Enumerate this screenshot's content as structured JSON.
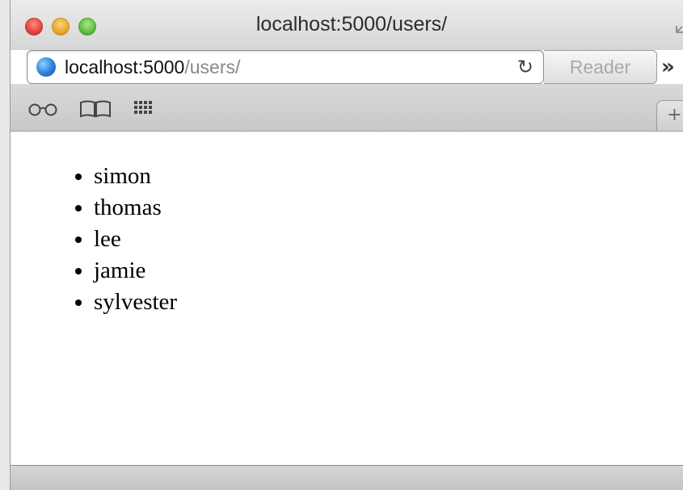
{
  "window": {
    "title": "localhost:5000/users/"
  },
  "address_bar": {
    "host": "localhost:5000",
    "path": "/users/",
    "reader_label": "Reader"
  },
  "icons": {
    "globe": "globe-icon",
    "reload": "reload-icon",
    "reading_list": "glasses-icon",
    "bookmarks": "book-icon",
    "top_sites": "grid-icon",
    "overflow": "chevron-double-right-icon",
    "new_tab": "plus-icon",
    "fullscreen": "fullscreen-icon"
  },
  "page": {
    "users": [
      "simon",
      "thomas",
      "lee",
      "jamie",
      "sylvester"
    ]
  },
  "colors": {
    "close": "#e0443e",
    "minimize": "#e8a92b",
    "maximize": "#5fbf3e"
  }
}
